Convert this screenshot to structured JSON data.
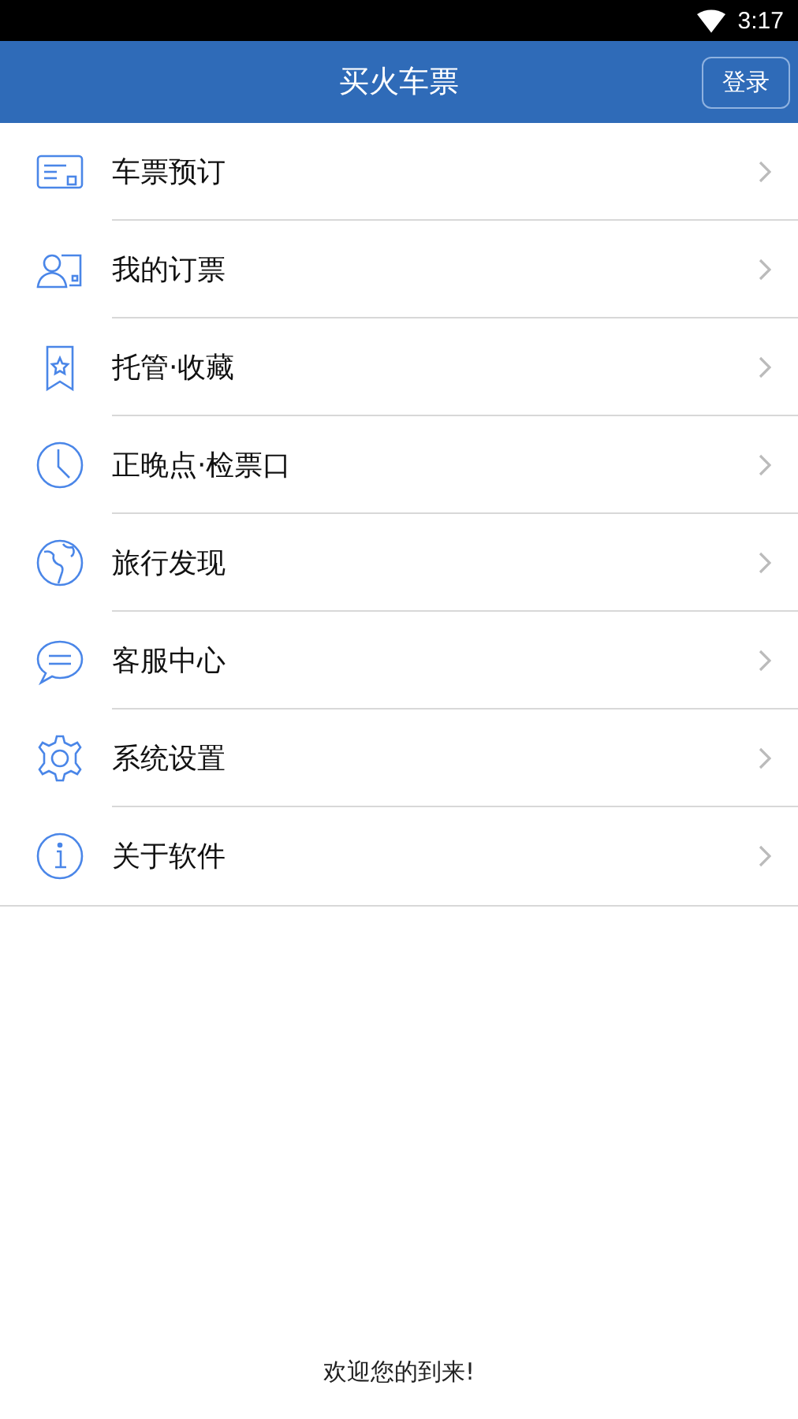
{
  "status_bar": {
    "time": "3:17"
  },
  "header": {
    "title": "买火车票",
    "login_button": "登录"
  },
  "menu_items": [
    {
      "label": "车票预订"
    },
    {
      "label": "我的订票"
    },
    {
      "label": "托管·收藏"
    },
    {
      "label": "正晚点·检票口"
    },
    {
      "label": "旅行发现"
    },
    {
      "label": "客服中心"
    },
    {
      "label": "系统设置"
    },
    {
      "label": "关于软件"
    }
  ],
  "footer": "欢迎您的到来!"
}
